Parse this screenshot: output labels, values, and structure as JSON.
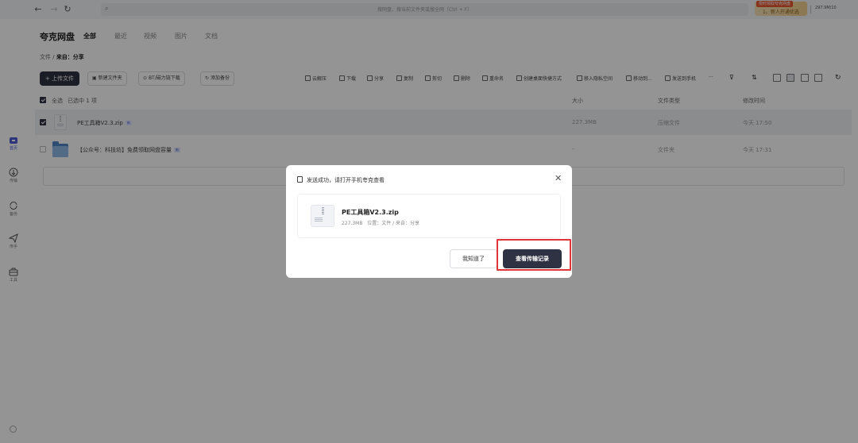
{
  "topbar": {
    "search_placeholder": "搜网盘、搜当前文件夹或搜全网（Ctrl + F）",
    "promo_tag": "限时领取夸克网盘",
    "promo_text": "1、新人开通优选",
    "storage": "297.9M/10"
  },
  "rail": {
    "items": [
      {
        "label": "首页",
        "icon": "home-icon"
      },
      {
        "label": "传输",
        "icon": "transfer-icon"
      },
      {
        "label": "备份",
        "icon": "backup-icon"
      },
      {
        "label": "传手",
        "icon": "send-icon"
      },
      {
        "label": "工具",
        "icon": "toolbox-icon"
      }
    ]
  },
  "header": {
    "brand": "夸克网盘",
    "tabs": [
      "全部",
      "最近",
      "视频",
      "图片",
      "文档"
    ]
  },
  "breadcrumb": {
    "root": "文件",
    "sep": " / ",
    "current": "来自：分享"
  },
  "toolbar": {
    "upload": "上传文件",
    "new_folder": "新建文件夹",
    "bt_download": "BT/磁力链下载",
    "add_backup": "添加备份",
    "actions": [
      "云解压",
      "下载",
      "分享",
      "复制",
      "剪切",
      "删除",
      "重命名",
      "创建桌面快捷方式",
      "移入隐私空间",
      "移动到...",
      "发送到手机",
      "···"
    ]
  },
  "table": {
    "select_all": "全选",
    "selected_count": "已选中 1 项",
    "headers": {
      "size": "大小",
      "type": "文件类型",
      "modified": "修改时间"
    },
    "rows": [
      {
        "name": "PE工具箱V2.3.zip",
        "tag": "新",
        "size": "227.3MB",
        "type": "压缩文件",
        "modified": "今天 17:50"
      },
      {
        "name": "【公众号：科技坊】免费领取网盘容量",
        "tag": "新",
        "size": "-",
        "type": "文件夹",
        "modified": "今天 17:31"
      }
    ]
  },
  "modal": {
    "title": "发送成功，请打开手机夸克查看",
    "file_name": "PE工具箱V2.3.zip",
    "file_size": "227.3MB",
    "file_location": "位置：文件 / 来自：分享",
    "ok_button": "我知道了",
    "primary_button": "查看传输记录"
  },
  "colors": {
    "primary": "#2f3242",
    "accent": "#4d5bd6",
    "highlight": "#e0333a"
  }
}
